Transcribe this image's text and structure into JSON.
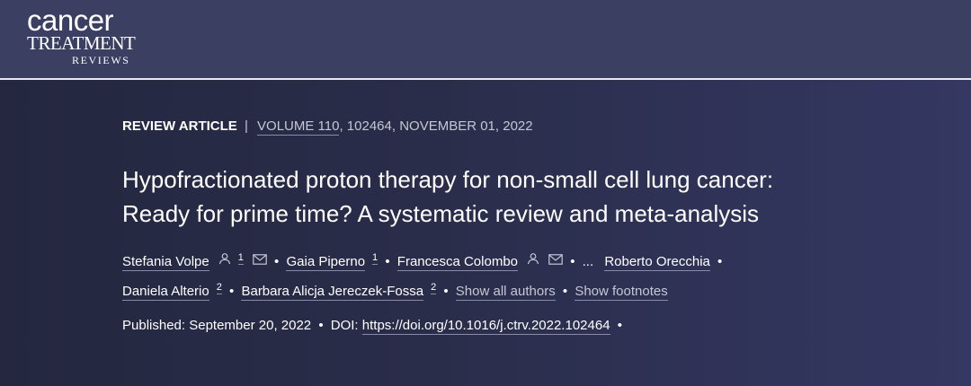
{
  "journal": {
    "logo_line1": "cancer",
    "logo_line2": "TREATMENT",
    "logo_line3": "REVIEWS"
  },
  "article": {
    "type": "REVIEW ARTICLE",
    "separator": "|",
    "volume": "VOLUME 110",
    "issue_info": ", 102464, NOVEMBER 01, 2022",
    "title_line1": "Hypofractionated proton therapy for non-small cell lung cancer:",
    "title_line2": "Ready for prime time? A systematic review and meta-analysis"
  },
  "authors": {
    "list": [
      {
        "name": "Stefania Volpe",
        "sup": "1"
      },
      {
        "name": "Gaia Piperno",
        "sup": "1"
      },
      {
        "name": "Francesca Colombo",
        "sup": ""
      },
      {
        "name": "Roberto Orecchia",
        "sup": ""
      },
      {
        "name": "Daniela Alterio",
        "sup": "2"
      },
      {
        "name": "Barbara Alicja Jereczek-Fossa",
        "sup": "2"
      }
    ],
    "ellipsis": "...",
    "bullet": "•",
    "show_all": "Show all authors",
    "show_footnotes": "Show footnotes"
  },
  "publication": {
    "published_label": "Published: September 20, 2022",
    "doi_label": "DOI:",
    "doi": "https://doi.org/10.1016/j.ctrv.2022.102464"
  },
  "icons": {
    "person": "person-icon",
    "mail": "mail-icon"
  },
  "colors": {
    "header_bg": "#3b3f62",
    "body_bg": "#2a2d4a",
    "muted_text": "#c6c7d4"
  }
}
